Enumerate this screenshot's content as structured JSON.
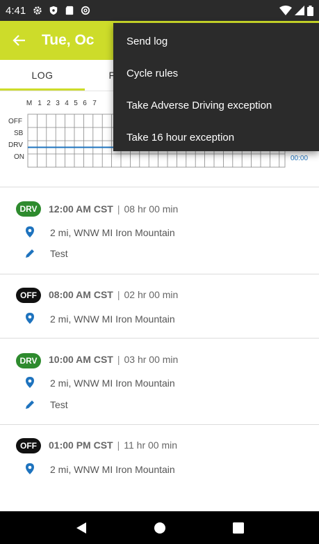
{
  "status_bar": {
    "time": "4:41",
    "icons": [
      "gear-icon",
      "shield-icon",
      "sd-card-icon",
      "at-sign-icon"
    ],
    "right_icons": [
      "wifi-icon",
      "signal-icon",
      "battery-icon"
    ]
  },
  "app_bar": {
    "title": "Tue, Oc",
    "back_icon": "arrow-left-icon",
    "background": "#cddc2a"
  },
  "tabs": [
    {
      "label": "LOG",
      "active": true
    },
    {
      "label": "F",
      "active": false
    }
  ],
  "grid": {
    "hours": [
      "M",
      "1",
      "2",
      "3",
      "4",
      "5",
      "6",
      "7"
    ],
    "rows": [
      "OFF",
      "SB",
      "DRV",
      "ON"
    ],
    "totals": {
      "on": "00:00"
    }
  },
  "menu": {
    "items": [
      "Send log",
      "Cycle rules",
      "Take Adverse Driving exception",
      "Take 16 hour exception"
    ]
  },
  "entries": [
    {
      "status": "DRV",
      "time": "12:00 AM CST",
      "separator": "|",
      "duration": "08 hr  00 min",
      "location": "2 mi, WNW MI Iron Mountain",
      "note": "Test"
    },
    {
      "status": "OFF",
      "time": "08:00 AM CST",
      "separator": "|",
      "duration": "02 hr  00 min",
      "location": "2 mi, WNW MI Iron Mountain"
    },
    {
      "status": "DRV",
      "time": "10:00 AM CST",
      "separator": "|",
      "duration": "03 hr  00 min",
      "location": "2 mi, WNW MI Iron Mountain",
      "note": "Test"
    },
    {
      "status": "OFF",
      "time": "01:00 PM CST",
      "separator": "|",
      "duration": "11 hr  00 min",
      "location": "2 mi, WNW MI Iron Mountain"
    }
  ],
  "colors": {
    "accent": "#cddc2a",
    "drv_badge": "#2e8b2e",
    "off_badge": "#111111",
    "icon_blue": "#1e73be"
  },
  "nav": [
    "back-nav-icon",
    "home-nav-icon",
    "recents-nav-icon"
  ]
}
